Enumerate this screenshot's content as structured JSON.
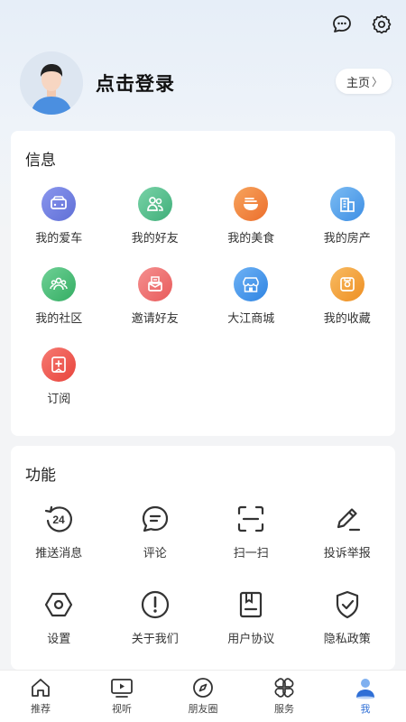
{
  "header": {
    "icons": [
      "message-icon",
      "settings-icon"
    ]
  },
  "profile": {
    "login_text": "点击登录",
    "home_label": "主页",
    "home_chevron": "〉"
  },
  "info": {
    "title": "信息",
    "items": [
      {
        "label": "我的爱车",
        "icon": "car-icon",
        "color": "#6f7fe0"
      },
      {
        "label": "我的好友",
        "icon": "friends-icon",
        "color": "#4fbf8c"
      },
      {
        "label": "我的美食",
        "icon": "food-icon",
        "color": "#f08a3a"
      },
      {
        "label": "我的房产",
        "icon": "building-icon",
        "color": "#4a9ee8"
      },
      {
        "label": "我的社区",
        "icon": "community-icon",
        "color": "#3dbb6e"
      },
      {
        "label": "邀请好友",
        "icon": "invite-icon",
        "color": "#f06a6a"
      },
      {
        "label": "大江商城",
        "icon": "shop-icon",
        "color": "#3c92ea"
      },
      {
        "label": "我的收藏",
        "icon": "favorite-icon",
        "color": "#f4a238"
      },
      {
        "label": "订阅",
        "icon": "subscribe-icon",
        "color": "#f2584f"
      }
    ]
  },
  "functions": {
    "title": "功能",
    "items": [
      {
        "label": "推送消息",
        "icon": "push-24-icon"
      },
      {
        "label": "评论",
        "icon": "comment-icon"
      },
      {
        "label": "扫一扫",
        "icon": "scan-icon"
      },
      {
        "label": "投诉举报",
        "icon": "report-pen-icon"
      },
      {
        "label": "设置",
        "icon": "hexagon-settings-icon"
      },
      {
        "label": "关于我们",
        "icon": "about-icon"
      },
      {
        "label": "用户协议",
        "icon": "agreement-icon"
      },
      {
        "label": "隐私政策",
        "icon": "privacy-shield-icon"
      }
    ],
    "badge_text": "24"
  },
  "tabbar": {
    "tabs": [
      {
        "label": "推荐",
        "icon": "home-icon"
      },
      {
        "label": "视听",
        "icon": "video-icon"
      },
      {
        "label": "朋友圈",
        "icon": "compass-icon"
      },
      {
        "label": "服务",
        "icon": "services-icon"
      },
      {
        "label": "我",
        "icon": "me-icon"
      }
    ],
    "active_index": 4,
    "active_color": "#2f6fd6"
  }
}
